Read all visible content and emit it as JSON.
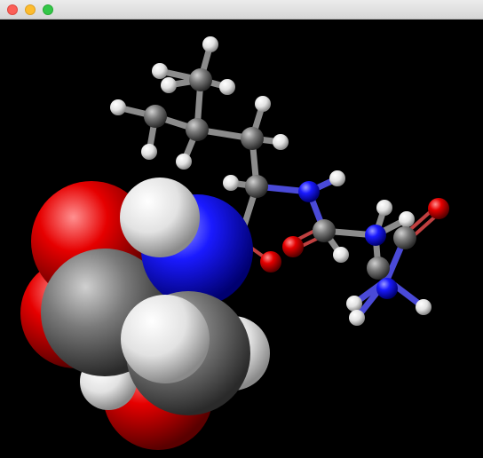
{
  "window": {
    "title": "",
    "buttons": [
      "close",
      "minimize",
      "zoom"
    ]
  },
  "viewer": {
    "background": "#000000",
    "element_colors": {
      "carbon": "#7a7a7a",
      "hydrogen": "#f2f2f2",
      "oxygen": "#e60000",
      "nitrogen": "#1a1aff"
    },
    "representations": [
      "space-filling",
      "ball-and-stick"
    ]
  }
}
